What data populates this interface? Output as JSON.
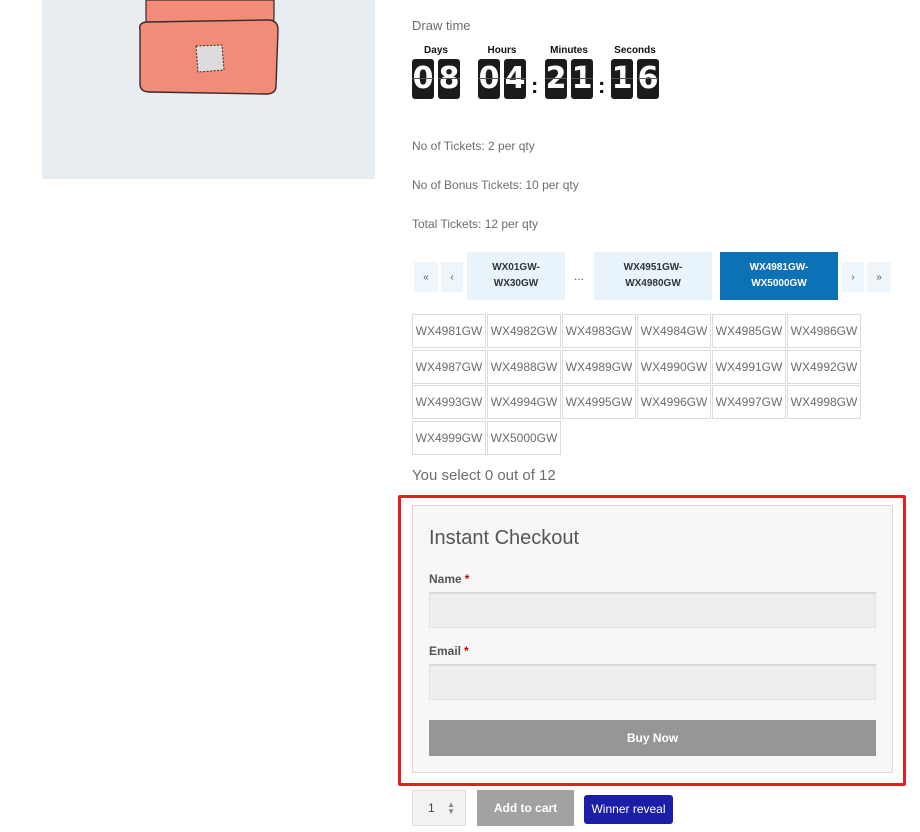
{
  "countdown": {
    "title": "Draw time",
    "units": [
      {
        "label": "Days",
        "digits": [
          "0",
          "8"
        ]
      },
      {
        "label": "Hours",
        "digits": [
          "0",
          "4"
        ]
      },
      {
        "label": "Minutes",
        "digits": [
          "2",
          "1"
        ]
      },
      {
        "label": "Seconds",
        "digits": [
          "1",
          "6"
        ]
      }
    ],
    "separator": ":"
  },
  "tickets_info": {
    "no_of_tickets": "No of Tickets: 2 per qty",
    "bonus_tickets": "No of Bonus Tickets: 10 per qty",
    "total_tickets": "Total Tickets: 12 per qty"
  },
  "pagination": {
    "first": "«",
    "prev": "‹",
    "ranges": [
      {
        "line1": "WX01GW-",
        "line2": "WX30GW"
      },
      {
        "line1": "WX4951GW-",
        "line2": "WX4980GW"
      },
      {
        "line1": "WX4981GW-",
        "line2": "WX5000GW"
      }
    ],
    "ellipsis": "...",
    "next": "›",
    "last": "»"
  },
  "tickets": [
    "WX4981GW",
    "WX4982GW",
    "WX4983GW",
    "WX4984GW",
    "WX4985GW",
    "WX4986GW",
    "WX4987GW",
    "WX4988GW",
    "WX4989GW",
    "WX4990GW",
    "WX4991GW",
    "WX4992GW",
    "WX4993GW",
    "WX4994GW",
    "WX4995GW",
    "WX4996GW",
    "WX4997GW",
    "WX4998GW",
    "WX4999GW",
    "WX5000GW"
  ],
  "selection_text": "You select 0 out of 12",
  "instant_checkout": {
    "title": "Instant Checkout",
    "name_label": "Name",
    "email_label": "Email",
    "required_mark": "*",
    "name_value": "",
    "email_value": "",
    "buy_now": "Buy Now"
  },
  "cart": {
    "quantity": "1",
    "spin_up": "▲",
    "spin_down": "▼",
    "add_to_cart": "Add to cart",
    "winner_reveal": "Winner reveal"
  },
  "colors": {
    "accent": "#0d72b5",
    "winner_button": "#1b1fa8",
    "highlight": "#e61e1e"
  }
}
